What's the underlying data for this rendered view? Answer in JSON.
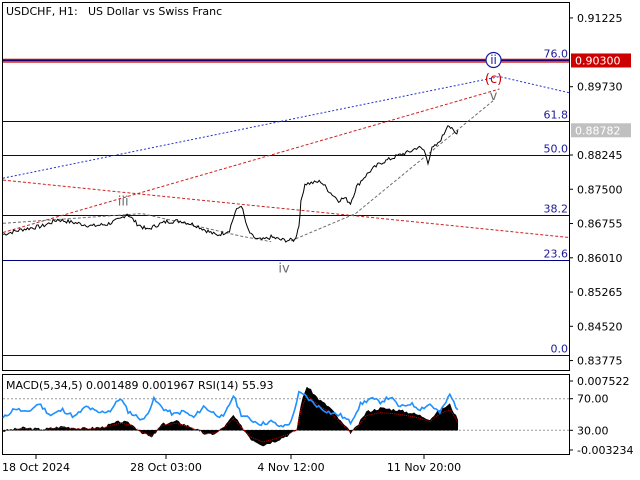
{
  "header": {
    "symbol": "USDCHF, H1:",
    "description": "US Dollar vs Swiss Franc"
  },
  "colors": {
    "price": "#000000",
    "fib": "#000080",
    "red_level": "#cc0000",
    "wave_blue": "#1a1aa0",
    "wave_red": "#cc0000",
    "wave_gray": "#6e6e6e",
    "blue_trend": "#2233cc",
    "red_trend": "#cc2222",
    "macd_fill": "#000000",
    "rsi": "#1e90ff",
    "price_tag_bg": "#c0c0c0"
  },
  "chart_data": [
    {
      "type": "line",
      "title": "",
      "y_ticks": [
        "0.91225",
        "0.89730",
        "0.88245",
        "0.87500",
        "0.86755",
        "0.86010",
        "0.85265",
        "0.84520",
        "0.83775"
      ],
      "x_ticks": [
        "18 Oct 2024",
        "28 Oct 03:00",
        "4 Nov 12:00",
        "11 Nov 20:00"
      ],
      "ylim": [
        0.8357,
        0.9155
      ],
      "x_range_bars": [
        0,
        570
      ],
      "price_path_x_bars": [
        0,
        20,
        40,
        55,
        70,
        90,
        105,
        118,
        125,
        135,
        145,
        155,
        165,
        180,
        195,
        205,
        215,
        222,
        228,
        234,
        240,
        246,
        250,
        256,
        262,
        270,
        280,
        288,
        294,
        296,
        298,
        300,
        304,
        312,
        320,
        330,
        338,
        344,
        350,
        356,
        362,
        370,
        380,
        390,
        400,
        410,
        418,
        424,
        428,
        432,
        438,
        444,
        448,
        452,
        456,
        458
      ],
      "price_path_y": [
        0.8652,
        0.8663,
        0.867,
        0.8684,
        0.8678,
        0.867,
        0.8674,
        0.8685,
        0.8697,
        0.8675,
        0.8662,
        0.8672,
        0.868,
        0.8681,
        0.8671,
        0.866,
        0.865,
        0.8655,
        0.8661,
        0.8701,
        0.8716,
        0.8665,
        0.865,
        0.8641,
        0.864,
        0.8646,
        0.864,
        0.8639,
        0.864,
        0.8655,
        0.8671,
        0.8721,
        0.8762,
        0.8764,
        0.8767,
        0.8742,
        0.8726,
        0.8731,
        0.872,
        0.8755,
        0.8772,
        0.879,
        0.8807,
        0.8816,
        0.8825,
        0.8832,
        0.8842,
        0.8835,
        0.8809,
        0.8838,
        0.8848,
        0.887,
        0.8892,
        0.888,
        0.8871,
        0.8878
      ],
      "current_price": "0.88782",
      "red_level": {
        "label": "0.90300",
        "value": 0.903
      },
      "fib_levels": [
        {
          "label": "76.0",
          "value": 0.903
        },
        {
          "label": "61.8",
          "value": 0.8899
        },
        {
          "label": "50.0",
          "value": 0.8824
        },
        {
          "label": "38.2",
          "value": 0.8693
        },
        {
          "label": "23.6",
          "value": 0.8596
        },
        {
          "label": "0.0",
          "value": 0.8389
        }
      ],
      "wave_labels": [
        {
          "text": "ii",
          "style": "circled",
          "x": 494,
          "y": 0.9031
        },
        {
          "text": "(c)",
          "style": "red",
          "x": 494,
          "y": 0.8992
        },
        {
          "text": "v",
          "style": "gray",
          "x": 494,
          "y": 0.8955
        },
        {
          "text": "iii",
          "style": "gray",
          "x": 121,
          "y": 0.8726
        },
        {
          "text": "iv",
          "style": "gray",
          "x": 283,
          "y": 0.858
        }
      ],
      "trend_lines": [
        {
          "style": "blue",
          "x": [
            0,
            500,
            570
          ],
          "y": [
            0.8774,
            0.8995,
            0.896
          ]
        },
        {
          "style": "red_dash",
          "x": [
            0,
            500
          ],
          "y": [
            0.8656,
            0.8968
          ]
        },
        {
          "style": "red_dash",
          "x": [
            0,
            570
          ],
          "y": [
            0.877,
            0.8645
          ]
        },
        {
          "style": "gray",
          "x": [
            0,
            140,
            240,
            270
          ],
          "y": [
            0.8676,
            0.8697,
            0.8648,
            0.8636
          ]
        },
        {
          "style": "gray",
          "x": [
            290,
            355,
            495
          ],
          "y": [
            0.8638,
            0.8697,
            0.8945
          ]
        }
      ]
    },
    {
      "type": "area",
      "title": "",
      "legend_text": "MACD(5,34,5) 0.001489 0.001967 RSI(14) 55.93",
      "y_ticks": [
        "0.007522",
        "70.00",
        "30.00",
        "-0.003234"
      ],
      "ylim": [
        -0.003234,
        0.007522
      ],
      "rsi_levels": [
        70,
        30
      ],
      "macd_x_bars": [
        0,
        20,
        40,
        60,
        80,
        100,
        118,
        128,
        140,
        150,
        160,
        175,
        190,
        205,
        215,
        225,
        232,
        240,
        250,
        262,
        275,
        288,
        296,
        300,
        306,
        318,
        330,
        340,
        350,
        356,
        366,
        380,
        395,
        410,
        420,
        430,
        440,
        450,
        458
      ],
      "macd_values": [
        -0.0001,
        0.0003,
        0.0001,
        0.0005,
        0.0002,
        0.0004,
        0.0012,
        0.0009,
        -0.0003,
        -0.001,
        0.0008,
        0.0012,
        0.0004,
        -0.0006,
        -0.0004,
        0.0008,
        0.002,
        0.0005,
        -0.0012,
        -0.002,
        -0.0014,
        -0.0006,
        0.0001,
        0.0035,
        0.006,
        0.0042,
        0.003,
        0.0012,
        -0.0003,
        0.0004,
        0.0025,
        0.003,
        0.0028,
        0.0024,
        0.002,
        0.0015,
        0.0028,
        0.0035,
        0.0014
      ],
      "rsi_x_bars": [
        0,
        12,
        24,
        36,
        48,
        60,
        72,
        84,
        96,
        108,
        118,
        126,
        134,
        142,
        152,
        162,
        172,
        182,
        192,
        202,
        212,
        222,
        232,
        240,
        250,
        260,
        270,
        280,
        290,
        298,
        304,
        312,
        320,
        330,
        340,
        350,
        360,
        370,
        380,
        390,
        400,
        410,
        420,
        430,
        440,
        450,
        458
      ],
      "rsi_values": [
        45,
        58,
        52,
        64,
        49,
        56,
        47,
        60,
        52,
        55,
        71,
        54,
        48,
        43,
        69,
        57,
        50,
        54,
        46,
        60,
        52,
        46,
        74,
        50,
        43,
        38,
        41,
        34,
        40,
        77,
        74,
        65,
        58,
        52,
        49,
        40,
        63,
        70,
        66,
        72,
        59,
        64,
        57,
        63,
        52,
        75,
        56
      ]
    }
  ]
}
